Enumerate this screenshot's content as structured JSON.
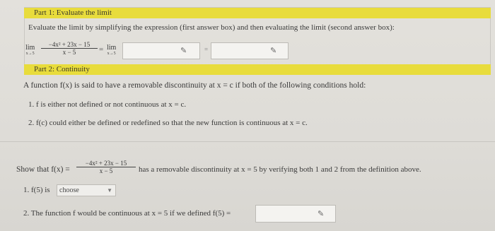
{
  "part1": {
    "title": "Part 1: Evaluate the limit",
    "instruction": "Evaluate the limit by simplifying the expression (first answer box) and then evaluating the limit (second answer box):",
    "lim_label": "lim",
    "lim_sub": "x→5",
    "numerator": "−4x² + 23x − 15",
    "denominator": "x − 5",
    "equals": "=",
    "second_lim_label": "lim",
    "second_lim_sub": "x→5",
    "box_equals": "="
  },
  "part2": {
    "title": "Part 2: Continuity",
    "definition": "A function f(x) is said to have a removable discontinuity at x = c if both of the following conditions hold:",
    "condition1": "1. f is either not defined or not continuous at x = c.",
    "condition2": "2. f(c) could either be defined or redefined so that the new function is continuous at x = c."
  },
  "show": {
    "prefix": "Show that f(x) =",
    "numerator": "−4x² + 23x − 15",
    "denominator": "x − 5",
    "suffix": "has a removable discontinuity at x = 5 by verifying both 1 and 2 from the definition above.",
    "item1_label": "1. f(5) is",
    "select_value": "choose",
    "item2_label": "2. The function f would be continuous at x = 5 if we defined f(5) ="
  },
  "icons": {
    "pencil": "pencil-icon",
    "caret": "chevron-down-icon"
  }
}
